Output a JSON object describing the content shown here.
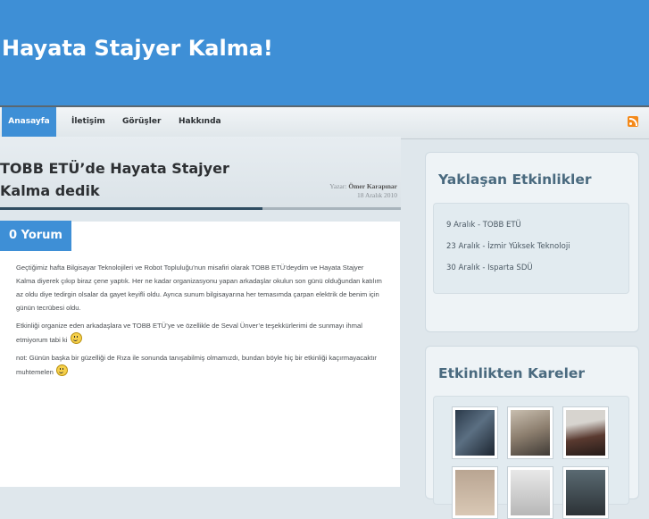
{
  "site": {
    "title": "Hayata Stajyer Kalma!"
  },
  "nav": {
    "items": [
      "Anasayfa",
      "İletişim",
      "Görüşler",
      "Hakkında"
    ],
    "rss_icon": "rss-icon"
  },
  "post": {
    "title": "TOBB ETÜ’de Hayata Stajyer Kalma dedik",
    "author_prefix": "Yazar:",
    "author": "Ömer Karapınar",
    "date": "18 Aralık 2010",
    "comments": "0 Yorum",
    "paragraphs": [
      "Geçtiğimiz hafta Bilgisayar Teknolojileri ve Robot Topluluğu’nun misafiri olarak TOBB ETÜ’deydim ve Hayata Stajyer Kalma diyerek çıkıp biraz çene yaptık. Her ne kadar organizasyonu yapan arkadaşlar okulun son günü olduğundan katılım az oldu diye tedirgin olsalar da gayet keyifli oldu. Ayrıca sunum bilgisayarına her temasımda çarpan elektrik de benim için günün tecrübesi oldu.",
      "Etkinliği organize eden arkadaşlara ve TOBB ETÜ’ye ve özellikle de Seval Ünver’e teşekkürlerimi de sunmayı ihmal etmiyorum tabi ki",
      "not: Günün başka bir güzelliği de Rıza ile sonunda tanışabilmiş olmamızdı, bundan böyle hiç bir etkinliği kaçırmayacaktır muhtemelen"
    ],
    "progress": 0.655
  },
  "sidebar": {
    "events_title": "Yaklaşan Etkinlikler",
    "events": [
      "9 Aralık - TOBB ETÜ",
      "23 Aralık - İzmir Yüksek Teknoloji",
      "30 Aralık - Isparta SDÜ"
    ],
    "photos_title": "Etkinlikten Kareler",
    "photos": [
      "photo-1",
      "photo-2",
      "photo-3",
      "photo-4",
      "photo-5",
      "photo-6"
    ]
  }
}
